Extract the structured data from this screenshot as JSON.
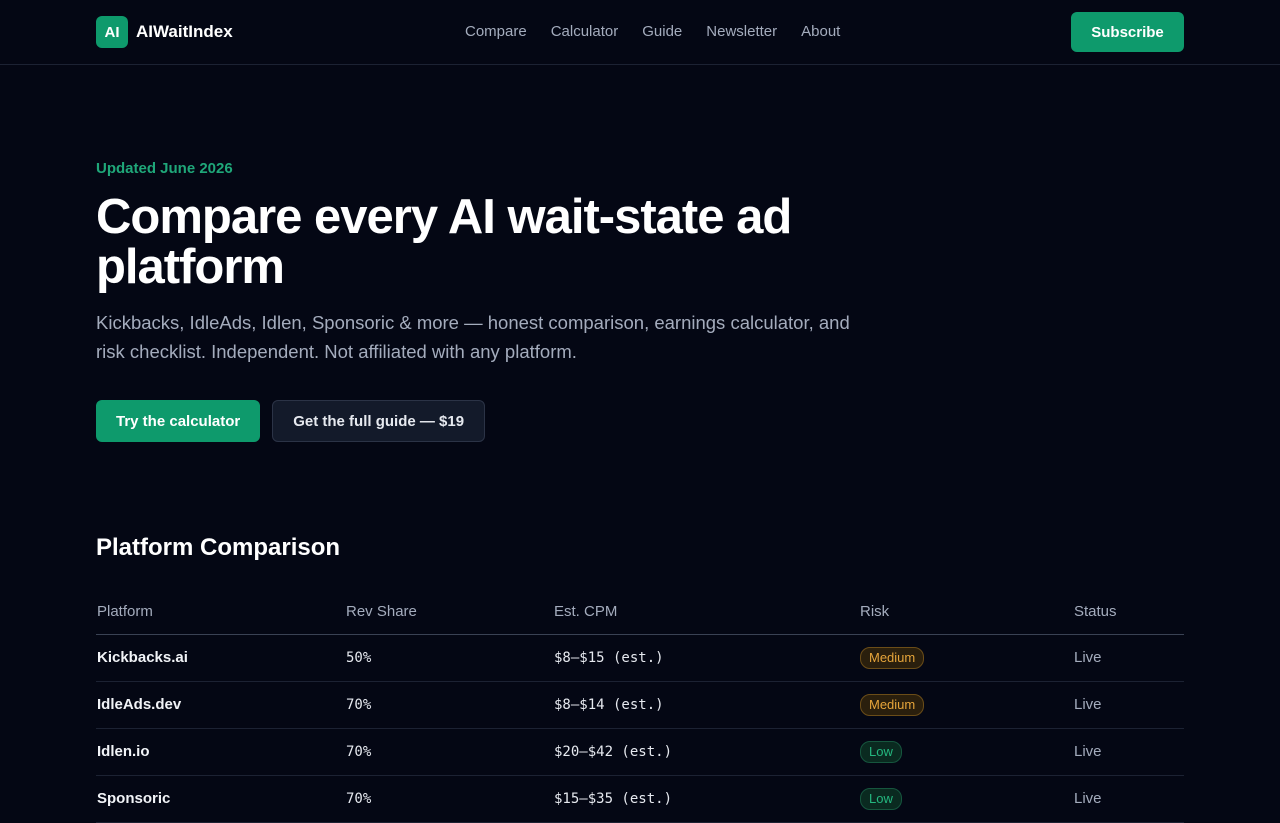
{
  "brand": {
    "logo_text": "AI",
    "name": "AIWaitIndex"
  },
  "nav": [
    "Compare",
    "Calculator",
    "Guide",
    "Newsletter",
    "About"
  ],
  "header": {
    "subscribe_label": "Subscribe"
  },
  "hero": {
    "updated": "Updated June 2026",
    "headline": "Compare every AI wait-state ad platform",
    "subtitle": "Kickbacks, IdleAds, Idlen, Sponsoric & more — honest comparison, earnings calculator, and risk checklist. Independent. Not affiliated with any platform.",
    "cta_primary": "Try the calculator",
    "cta_secondary": "Get the full guide — $19"
  },
  "comparison": {
    "title": "Platform Comparison",
    "columns": [
      "Platform",
      "Rev Share",
      "Est. CPM",
      "Risk",
      "Status"
    ],
    "rows": [
      {
        "platform": "Kickbacks.ai",
        "rev_share": "50%",
        "cpm": "$8–$15 (est.)",
        "risk": "Medium",
        "status": "Live"
      },
      {
        "platform": "IdleAds.dev",
        "rev_share": "70%",
        "cpm": "$8–$14 (est.)",
        "risk": "Medium",
        "status": "Live"
      },
      {
        "platform": "Idlen.io",
        "rev_share": "70%",
        "cpm": "$20–$42 (est.)",
        "risk": "Low",
        "status": "Live"
      },
      {
        "platform": "Sponsoric",
        "rev_share": "70%",
        "cpm": "$15–$35 (est.)",
        "risk": "Low",
        "status": "Live"
      }
    ]
  },
  "colors": {
    "accent": "#0e9a6c",
    "background": "#040714",
    "risk_medium": "#e5a43a",
    "risk_low": "#24b77f"
  }
}
